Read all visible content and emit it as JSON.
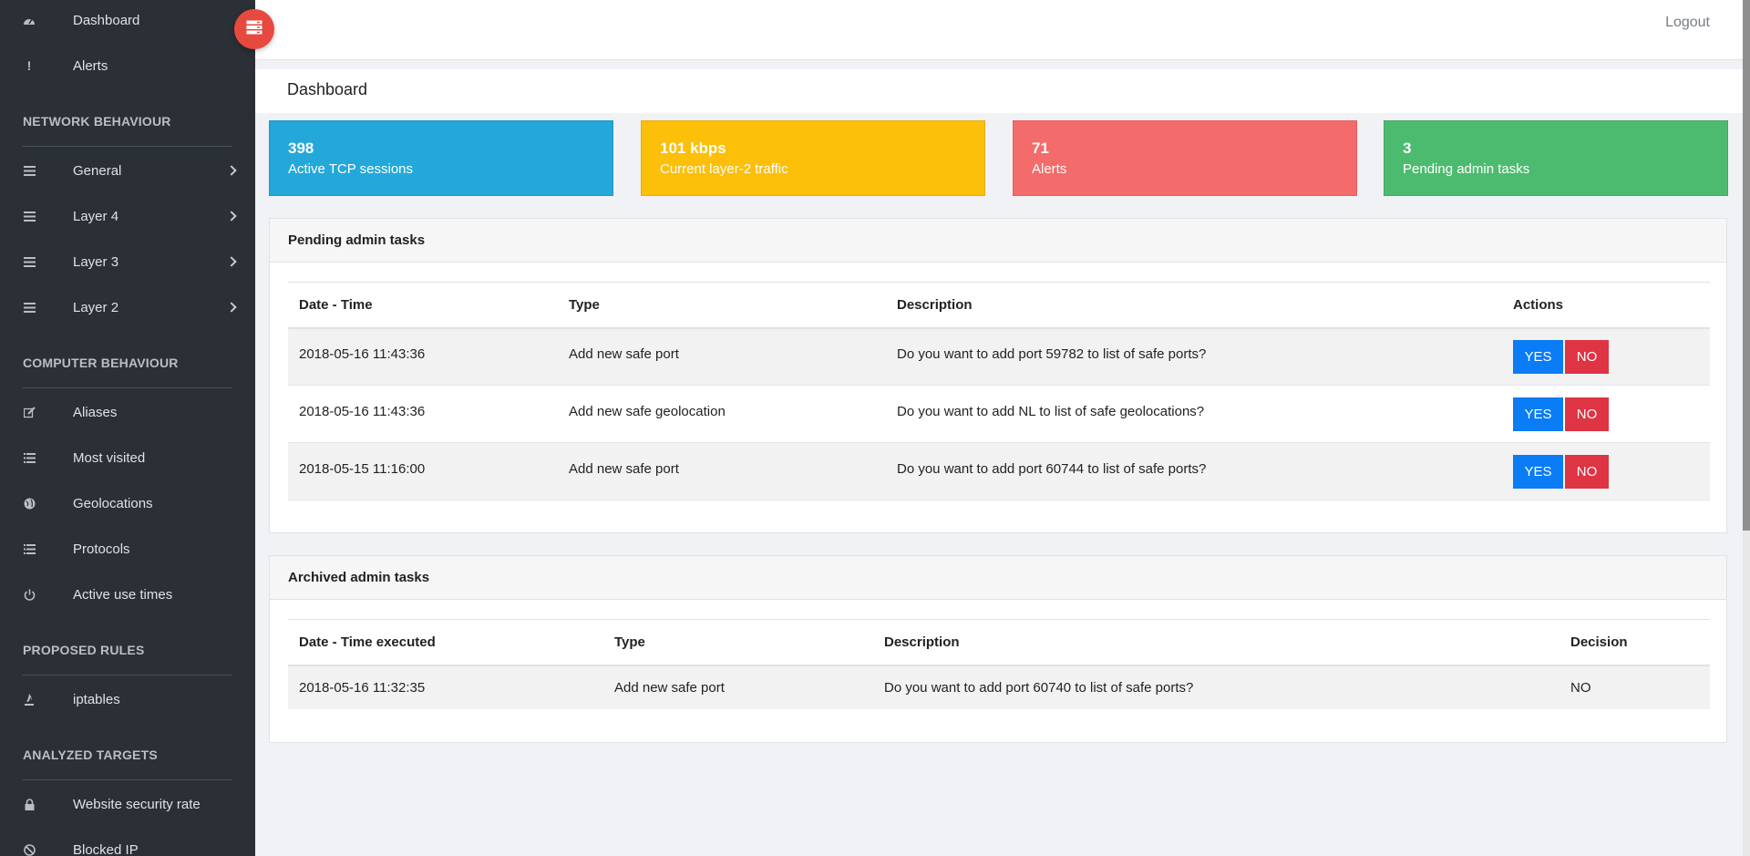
{
  "sidebar": {
    "top_items": [
      {
        "label": "Dashboard",
        "icon": "dashboard-icon"
      },
      {
        "label": "Alerts",
        "icon": "exclamation-icon"
      }
    ],
    "sections": {
      "network": {
        "title": "NETWORK BEHAVIOUR",
        "items": [
          {
            "label": "General",
            "icon": "bars-icon"
          },
          {
            "label": "Layer 4",
            "icon": "bars-icon"
          },
          {
            "label": "Layer 3",
            "icon": "bars-icon"
          },
          {
            "label": "Layer 2",
            "icon": "bars-icon"
          }
        ]
      },
      "computer": {
        "title": "COMPUTER BEHAVIOUR",
        "items": [
          {
            "label": "Aliases",
            "icon": "edit-icon"
          },
          {
            "label": "Most visited",
            "icon": "list-icon"
          },
          {
            "label": "Geolocations",
            "icon": "globe-icon"
          },
          {
            "label": "Protocols",
            "icon": "list-icon"
          },
          {
            "label": "Active use times",
            "icon": "power-icon"
          }
        ]
      },
      "rules": {
        "title": "PROPOSED RULES",
        "items": [
          {
            "label": "iptables",
            "icon": "fire-icon"
          }
        ]
      },
      "targets": {
        "title": "ANALYZED TARGETS",
        "items": [
          {
            "label": "Website security rate",
            "icon": "lock-icon"
          },
          {
            "label": "Blocked IP",
            "icon": "ban-icon"
          }
        ]
      }
    }
  },
  "topbar": {
    "logout_label": "Logout"
  },
  "page": {
    "title": "Dashboard"
  },
  "stats": [
    {
      "value": "398",
      "label": "Active TCP sessions",
      "color": "#23a8d9"
    },
    {
      "value": "101 kbps",
      "label": "Current layer-2 traffic",
      "color": "#fcbf0a"
    },
    {
      "value": "71",
      "label": "Alerts",
      "color": "#f46b6b"
    },
    {
      "value": "3",
      "label": "Pending admin tasks",
      "color": "#4dbb6f"
    }
  ],
  "pending": {
    "title": "Pending admin tasks",
    "columns": [
      "Date - Time",
      "Type",
      "Description",
      "Actions"
    ],
    "rows": [
      {
        "datetime": "2018-05-16 11:43:36",
        "type": "Add new safe port",
        "description": "Do you want to add port 59782 to list of safe ports?"
      },
      {
        "datetime": "2018-05-16 11:43:36",
        "type": "Add new safe geolocation",
        "description": "Do you want to add NL to list of safe geolocations?"
      },
      {
        "datetime": "2018-05-15 11:16:00",
        "type": "Add new safe port",
        "description": "Do you want to add port 60744 to list of safe ports?"
      }
    ],
    "yes_label": "YES",
    "no_label": "NO"
  },
  "archived": {
    "title": "Archived admin tasks",
    "columns": [
      "Date - Time executed",
      "Type",
      "Description",
      "Decision"
    ],
    "rows": [
      {
        "datetime": "2018-05-16 11:32:35",
        "type": "Add new safe port",
        "description": "Do you want to add port 60740 to list of safe ports?",
        "decision": "NO"
      }
    ]
  }
}
